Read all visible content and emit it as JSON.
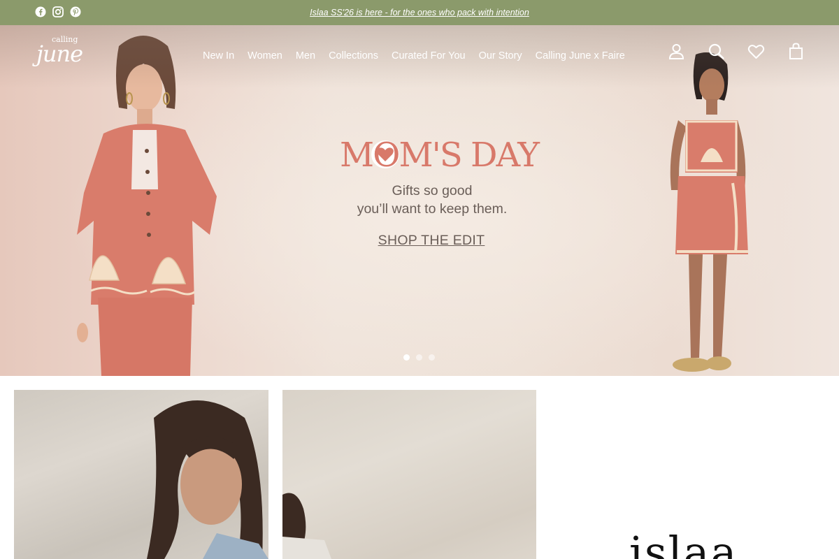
{
  "announcement": {
    "text": "Islaa SS'26 is here - for the ones who pack with intention"
  },
  "social": [
    "facebook-icon",
    "instagram-icon",
    "pinterest-icon"
  ],
  "logo": {
    "top": "calling",
    "main": "june"
  },
  "nav": {
    "items": [
      {
        "label": "New In"
      },
      {
        "label": "Women"
      },
      {
        "label": "Men"
      },
      {
        "label": "Collections"
      },
      {
        "label": "Curated For You"
      },
      {
        "label": "Our Story"
      },
      {
        "label": "Calling June x Faire"
      }
    ]
  },
  "header_icons": [
    "account-icon",
    "search-icon",
    "wishlist-icon",
    "cart-icon"
  ],
  "hero": {
    "headline": "MOM'S DAY",
    "subtitle_line1": "Gifts so good",
    "subtitle_line2": "you’ll want to keep them.",
    "cta": "SHOP THE EDIT",
    "slides": 3,
    "active_slide": 1
  },
  "colors": {
    "announcement_bg": "#8b9a6b",
    "headline": "#d8796a",
    "outfit": "#d97c6b",
    "text": "#6a5e58"
  },
  "brand_feature": {
    "word": "islaa"
  }
}
